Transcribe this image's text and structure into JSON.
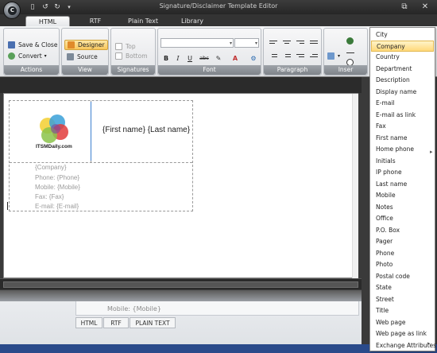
{
  "window": {
    "title": "Signature/Disclaimer Template Editor",
    "orb_glyph": "C",
    "quick_access": [
      "new-icon",
      "undo-icon",
      "redo-icon",
      "dropdown-icon"
    ],
    "controls": [
      "restore-icon",
      "close-icon"
    ]
  },
  "ribbon_tabs": [
    {
      "label": "HTML",
      "active": true
    },
    {
      "label": "RTF"
    },
    {
      "label": "Plain Text"
    },
    {
      "label": "Library"
    }
  ],
  "ribbon": {
    "actions": {
      "label": "Actions",
      "save_close": "Save & Close",
      "convert": "Convert"
    },
    "view": {
      "label": "View",
      "designer": "Designer",
      "source": "Source"
    },
    "signatures": {
      "label": "Signatures",
      "top": "Top",
      "bottom": "Bottom"
    },
    "font": {
      "label": "Font",
      "font_name": "",
      "font_size": "",
      "bold": "B",
      "italic": "I",
      "underline": "U",
      "strike": "abc"
    },
    "paragraph": {
      "label": "Paragraph"
    },
    "insert": {
      "label": "Inser"
    }
  },
  "editor": {
    "name_field": "{First name} {Last name}",
    "logo_text": "ITSMDaily.com",
    "lines": [
      "{Company}",
      "Phone: {Phone}",
      "Mobile: {Mobile}",
      "Fax: {Fax}",
      "E-mail: {E-mail}"
    ]
  },
  "preview": {
    "mobile_line": "Mobile: {Mobile}"
  },
  "bottom_tabs": [
    "HTML",
    "RTF",
    "PLAIN TEXT"
  ],
  "dropdown": {
    "items": [
      "City",
      "Company",
      "Country",
      "Department",
      "Description",
      "Display name",
      "E-mail",
      "E-mail as link",
      "Fax",
      "First name",
      "Home phone",
      "Initials",
      "IP phone",
      "Last name",
      "Mobile",
      "Notes",
      "Office",
      "P.O. Box",
      "Pager",
      "Phone",
      "Photo",
      "Postal code",
      "State",
      "Street",
      "Title",
      "Web page",
      "Web page as link",
      "Exchange Attributes"
    ],
    "highlighted": "Company"
  },
  "colors": {
    "accent_highlight": "#ffd97a",
    "selected_button": "#f8c65c",
    "title_bar": "#2b2b2b",
    "cursor": "#3c7fd0"
  }
}
